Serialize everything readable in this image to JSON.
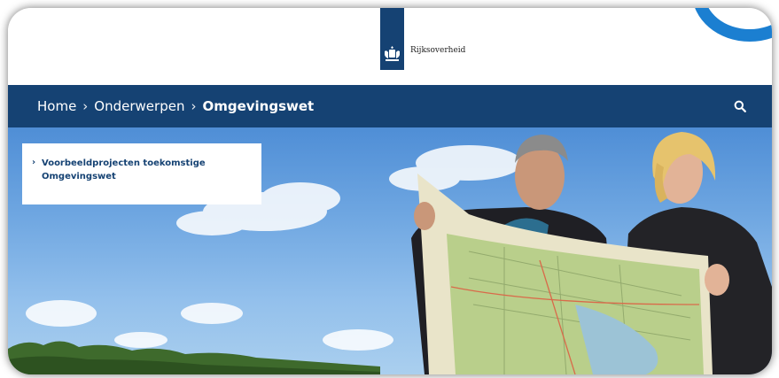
{
  "header": {
    "logo_text": "Rijksoverheid"
  },
  "nav": {
    "breadcrumbs": [
      "Home",
      "Onderwerpen",
      "Omgevingswet"
    ],
    "separator": "›"
  },
  "sidebar": {
    "link_label": "Voorbeeldprojecten toekomstige Omgevingswet",
    "chevron": "›"
  },
  "colors": {
    "nav_bg": "#154273",
    "link_text": "#154273",
    "corner_accent": "#1b7fd1"
  },
  "icons": {
    "logo": "coat-of-arms-icon",
    "search": "search-icon",
    "link": "chevron-right-icon"
  }
}
